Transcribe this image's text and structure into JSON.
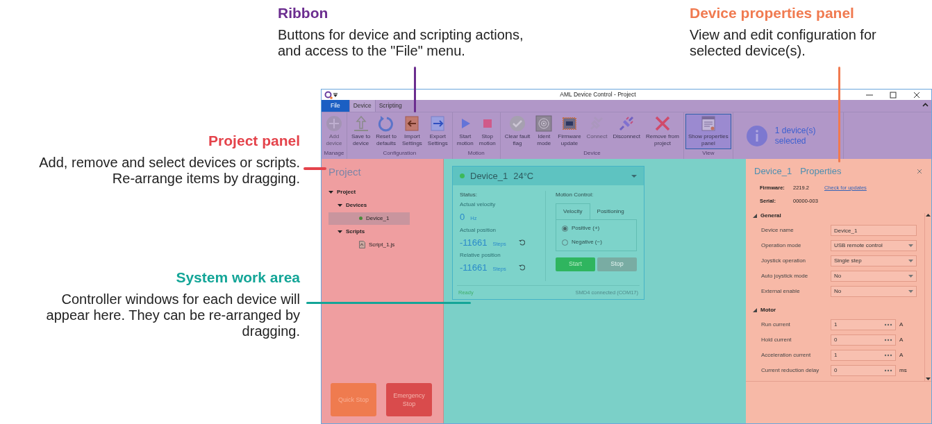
{
  "annotations": [
    {
      "title": "Ribbon",
      "text": "Buttons for device and scripting actions, and access to the \"File\" menu.",
      "color": "#6b2d8f"
    },
    {
      "title": "Device properties panel",
      "text": "View and edit configuration for selected device(s).",
      "color": "#f07a50"
    },
    {
      "title": "Project panel",
      "text": "Add, remove and select devices or scripts. Re-arrange items by dragging.",
      "color": "#e4434b"
    },
    {
      "title": "System work area",
      "text": "Controller windows for each device will appear here. They can be re-arranged by dragging.",
      "color": "#13a597"
    }
  ],
  "window": {
    "title": "AML Device Control - Project"
  },
  "ribbon": {
    "tabs": [
      {
        "label": "File",
        "kind": "menu",
        "selected": false
      },
      {
        "label": "Device",
        "kind": "tab",
        "selected": true
      },
      {
        "label": "Scripting",
        "kind": "tab",
        "selected": false
      }
    ],
    "groups": [
      {
        "label": "Manage",
        "buttons": [
          {
            "label": "Add\ndevice",
            "disabled": true,
            "on": false
          }
        ]
      },
      {
        "label": "Configuration",
        "buttons": [
          {
            "label": "Save to\ndevice",
            "disabled": false,
            "on": false
          },
          {
            "label": "Reset to\ndefaults",
            "disabled": false,
            "on": false
          },
          {
            "label": "Import\nSettings",
            "disabled": false,
            "on": false
          },
          {
            "label": "Export\nSettings",
            "disabled": false,
            "on": false
          }
        ]
      },
      {
        "label": "Motion",
        "buttons": [
          {
            "label": "Start\nmotion",
            "disabled": false,
            "on": false
          },
          {
            "label": "Stop\nmotion",
            "disabled": false,
            "on": false
          }
        ]
      },
      {
        "label": "Device",
        "buttons": [
          {
            "label": "Clear fault\nflag",
            "disabled": false,
            "on": false
          },
          {
            "label": "Ident\nmode",
            "disabled": false,
            "on": false
          },
          {
            "label": "Firmware\nupdate",
            "disabled": false,
            "on": false
          },
          {
            "label": "Connect",
            "disabled": true,
            "on": false
          },
          {
            "label": "Disconnect",
            "disabled": false,
            "on": false
          },
          {
            "label": "Remove from\nproject",
            "disabled": false,
            "on": false
          }
        ]
      },
      {
        "label": "View",
        "buttons": [
          {
            "label": "Show properties\npanel",
            "disabled": false,
            "on": true
          }
        ]
      }
    ],
    "info": "1 device(s)\nselected"
  },
  "project": {
    "title": "Project",
    "tree": [
      {
        "label": "Project",
        "expanded": true,
        "selected": false,
        "children": [
          {
            "label": "Devices",
            "expanded": true,
            "selected": false,
            "children": [
              {
                "label": "Device_1",
                "kind": "device",
                "color": "#4a8a3a",
                "selected": true
              }
            ]
          },
          {
            "label": "Scripts",
            "expanded": true,
            "selected": false,
            "children": [
              {
                "label": "Script_1.js",
                "kind": "script",
                "selected": false
              }
            ]
          }
        ]
      }
    ],
    "stop_buttons": [
      {
        "label": "Quick Stop",
        "kind": "quick"
      },
      {
        "label": "Emergency\nStop",
        "kind": "emergency"
      }
    ]
  },
  "device_window": {
    "title": "Device_1",
    "temperature": "24°C",
    "color": "#3cb95a",
    "status_label": "Status:",
    "readings": [
      {
        "label": "Actual velocity",
        "value": "0",
        "unit": "Hz",
        "reset": false
      },
      {
        "label": "Actual position",
        "value": "-11661",
        "unit": "Steps",
        "reset": true
      },
      {
        "label": "Relative position",
        "value": "-11661",
        "unit": "Steps",
        "reset": true
      }
    ],
    "motion_label": "Motion Control:",
    "tabs": [
      {
        "label": "Velocity",
        "selected": true
      },
      {
        "label": "Positioning",
        "selected": false
      }
    ],
    "directions": [
      {
        "label": "Positive (+)",
        "selected": true
      },
      {
        "label": "Negative (−)",
        "selected": false
      }
    ],
    "buttons": [
      {
        "label": "Start",
        "disabled": false
      },
      {
        "label": "Stop",
        "disabled": true
      }
    ],
    "state": "Ready",
    "connection": "SMD4 connected (COM17)"
  },
  "properties": {
    "title": "Device_1",
    "subtitle": "Properties",
    "firmware_label": "Firmware:",
    "firmware": "2219.2",
    "update_link": "Check for updates",
    "serial_label": "Serial:",
    "serial": "00000-003",
    "sections": [
      {
        "title": "General",
        "expanded": true,
        "rows": [
          {
            "label": "Device name",
            "kind": "text",
            "value": "Device_1"
          },
          {
            "label": "Operation mode",
            "kind": "select",
            "value": "USB remote control"
          },
          {
            "label": "Joystick operation",
            "kind": "select",
            "value": "Single step"
          },
          {
            "label": "Auto joystick mode",
            "kind": "select",
            "value": "No"
          },
          {
            "label": "External enable",
            "kind": "select",
            "value": "No"
          }
        ]
      },
      {
        "title": "Motor",
        "expanded": true,
        "rows": [
          {
            "label": "Run current",
            "kind": "number",
            "value": "1",
            "unit": "A"
          },
          {
            "label": "Hold current",
            "kind": "number",
            "value": "0",
            "unit": "A"
          },
          {
            "label": "Acceleration current",
            "kind": "number",
            "value": "1",
            "unit": "A"
          },
          {
            "label": "Current reduction delay",
            "kind": "number",
            "value": "0",
            "unit": "ms"
          }
        ]
      }
    ]
  }
}
